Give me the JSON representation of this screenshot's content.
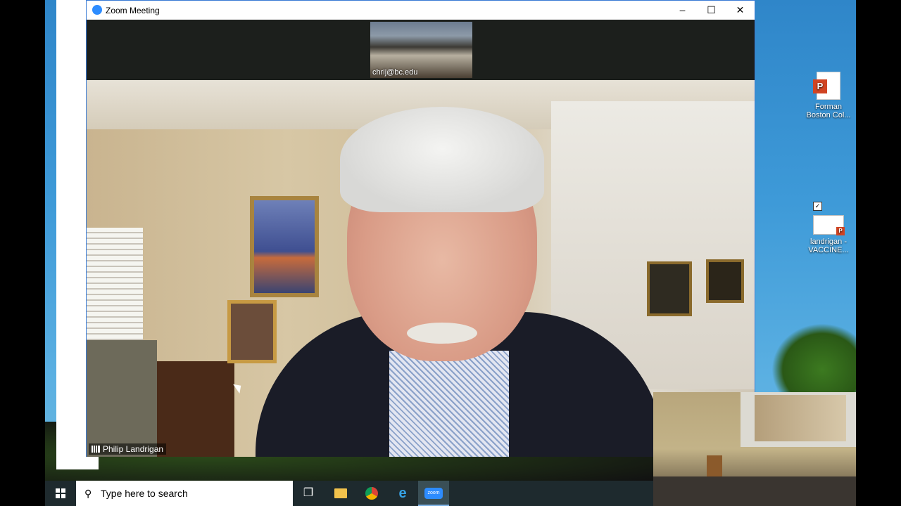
{
  "zoom_window": {
    "title": "Zoom Meeting",
    "controls": {
      "minimize": "–",
      "maximize": "☐",
      "close": "✕"
    },
    "thumbnail_participant": "chrij@bc.edu",
    "active_speaker": "Philip Landrigan"
  },
  "desktop_icons": [
    {
      "label_line1": "Forman",
      "label_line2": "Boston Col..."
    },
    {
      "label_line1": "landrigan -",
      "label_line2": "VACCINE..."
    }
  ],
  "taskbar": {
    "search_placeholder": "Type here to search",
    "zoom_app_label": "zoom"
  },
  "colors": {
    "zoom_blue": "#2d8cff",
    "taskbar": "#1e2a2e",
    "ppt_red": "#d04423"
  }
}
